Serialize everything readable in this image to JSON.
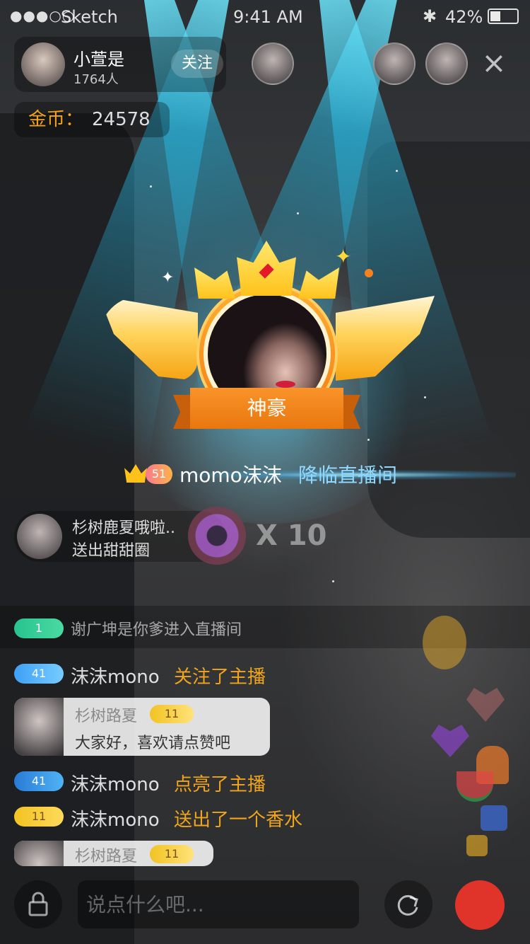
{
  "status_bar": {
    "signal": "●●●○○",
    "carrier": "Sketch",
    "time": "9:41 AM",
    "battery": "42%"
  },
  "host": {
    "name": "小萱是",
    "viewers": "1764人",
    "follow_label": "关注"
  },
  "coins": {
    "label": "金币：",
    "value": "24578"
  },
  "badge": {
    "title": "神豪"
  },
  "enter_banner": {
    "level": "51",
    "user": "momo沫沫",
    "message": "降临直播间"
  },
  "gift": {
    "sender": "杉树鹿夏哦啦..",
    "action": "送出甜甜圈",
    "count": "X 10"
  },
  "chat": [
    {
      "level": "1",
      "user": "谢广坤是你爹进入直播间",
      "action": ""
    },
    {
      "level": "41",
      "user": "沫沫mono",
      "action": "关注了主播"
    },
    {
      "level": "41",
      "user": "沫沫mono",
      "action": "点亮了主播"
    },
    {
      "level": "11",
      "user": "沫沫mono",
      "action": "送出了一个香水"
    }
  ],
  "bubbles": [
    {
      "name": "杉树路夏",
      "level": "11",
      "text": "大家好，喜欢请点赞吧"
    },
    {
      "name": "杉树路夏",
      "level": "11",
      "text": ""
    }
  ],
  "input": {
    "placeholder": "说点什么吧..."
  },
  "colors": {
    "accent": "#f7a21b",
    "beam": "#5fdcff",
    "ribbon": "#f08a1c",
    "enter_msg": "#8fd8ff",
    "red_button": "#e0342b"
  },
  "icons": [
    "lock-icon",
    "share-icon",
    "close-icon",
    "crown-icon",
    "diamond-icon",
    "star-icon",
    "donut-icon",
    "heart-icon"
  ]
}
